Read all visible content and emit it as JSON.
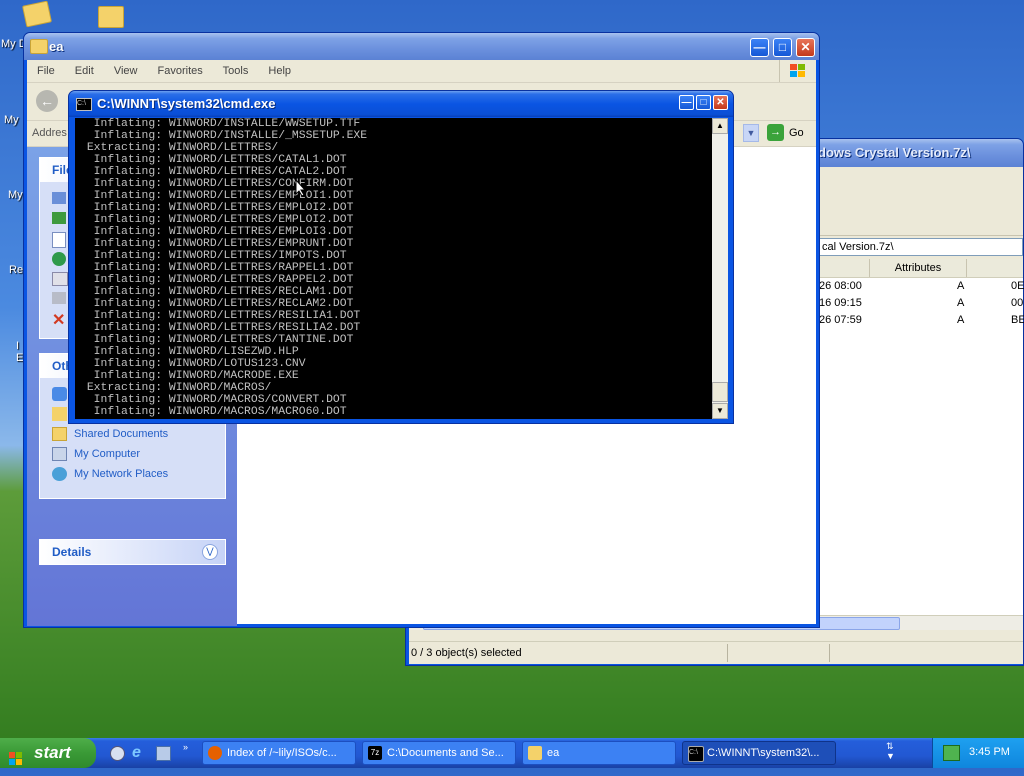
{
  "desktop": {
    "icons": [
      {
        "label": "My D"
      },
      {
        "label": "My"
      },
      {
        "label": "My"
      },
      {
        "label": "Re"
      },
      {
        "label": "I"
      },
      {
        "label": "E"
      }
    ]
  },
  "explorer": {
    "title": "ea",
    "menu": [
      "File",
      "Edit",
      "View",
      "Favorites",
      "Tools",
      "Help"
    ],
    "address_label": "Addres",
    "go_label": "Go",
    "file_tasks_head": "File",
    "other_places_head": "Oth",
    "other_places": [
      "Shared Documents",
      "My Computer",
      "My Network Places"
    ],
    "details_head": "Details"
  },
  "sevenzip": {
    "title_fragment": "dows Crystal Version.7z\\",
    "path_fragment": "cal Version.7z\\",
    "attributes_header": "Attributes",
    "rows": [
      {
        "date": "26 08:00",
        "attr": "A",
        "extra": "0E"
      },
      {
        "date": "16 09:15",
        "attr": "A",
        "extra": "00"
      },
      {
        "date": "26 07:59",
        "attr": "A",
        "extra": "BE"
      }
    ],
    "status": "0 / 3 object(s) selected"
  },
  "cmd": {
    "title": "C:\\WINNT\\system32\\cmd.exe",
    "lines": [
      "  Inflating: WINWORD/INSTALLE/WWSETUP.TTF",
      "  Inflating: WINWORD/INSTALLE/_MSSETUP.EXE",
      " Extracting: WINWORD/LETTRES/",
      "  Inflating: WINWORD/LETTRES/CATAL1.DOT",
      "  Inflating: WINWORD/LETTRES/CATAL2.DOT",
      "  Inflating: WINWORD/LETTRES/CONFIRM.DOT",
      "  Inflating: WINWORD/LETTRES/EMPLOI1.DOT",
      "  Inflating: WINWORD/LETTRES/EMPLOI2.DOT",
      "  Inflating: WINWORD/LETTRES/EMPLOI2.DOT",
      "  Inflating: WINWORD/LETTRES/EMPLOI3.DOT",
      "  Inflating: WINWORD/LETTRES/EMPRUNT.DOT",
      "  Inflating: WINWORD/LETTRES/IMPOTS.DOT",
      "  Inflating: WINWORD/LETTRES/RAPPEL1.DOT",
      "  Inflating: WINWORD/LETTRES/RAPPEL2.DOT",
      "  Inflating: WINWORD/LETTRES/RECLAM1.DOT",
      "  Inflating: WINWORD/LETTRES/RECLAM2.DOT",
      "  Inflating: WINWORD/LETTRES/RESILIA1.DOT",
      "  Inflating: WINWORD/LETTRES/RESILIA2.DOT",
      "  Inflating: WINWORD/LETTRES/TANTINE.DOT",
      "  Inflating: WINWORD/LISEZWD.HLP",
      "  Inflating: WINWORD/LOTUS123.CNV",
      "  Inflating: WINWORD/MACRODE.EXE",
      " Extracting: WINWORD/MACROS/",
      "  Inflating: WINWORD/MACROS/CONVERT.DOT",
      "  Inflating: WINWORD/MACROS/MACRO60.DOT"
    ]
  },
  "taskbar": {
    "start_label": "start",
    "tasks": [
      {
        "label": "Index of /~lily/ISOs/c...",
        "icon": "firefox-icon"
      },
      {
        "label": "C:\\Documents and Se...",
        "icon": "7zip-icon"
      },
      {
        "label": "ea",
        "icon": "folder-icon"
      },
      {
        "label": "C:\\WINNT\\system32\\...",
        "icon": "cmd-icon",
        "active": true
      }
    ],
    "clock": "3:45 PM"
  }
}
